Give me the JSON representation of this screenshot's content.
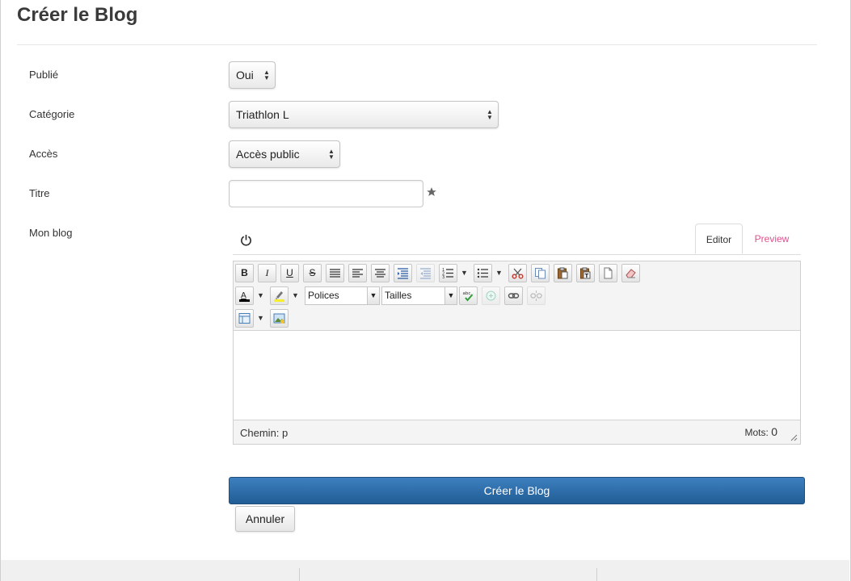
{
  "page": {
    "title": "Créer le Blog"
  },
  "form": {
    "published": {
      "label": "Publié",
      "value": "Oui"
    },
    "category": {
      "label": "Catégorie",
      "value": "Triathlon L"
    },
    "access": {
      "label": "Accès",
      "value": "Accès public"
    },
    "title": {
      "label": "Titre",
      "value": "",
      "required_icon": "star-icon"
    },
    "blog": {
      "label": "Mon blog"
    }
  },
  "editor": {
    "tabs": [
      {
        "label": "Editor",
        "active": true
      },
      {
        "label": "Preview",
        "active": false
      }
    ],
    "toolbar": {
      "font_family": "Polices",
      "font_size": "Tailles"
    },
    "status": {
      "path_label": "Chemin:",
      "path_value": "p",
      "words_label": "Mots:",
      "words_value": "0"
    }
  },
  "actions": {
    "submit_label": "Créer le Blog",
    "cancel_label": "Annuler"
  },
  "colors": {
    "primary": "#2a6aa8",
    "tab_link": "#e0508f"
  }
}
